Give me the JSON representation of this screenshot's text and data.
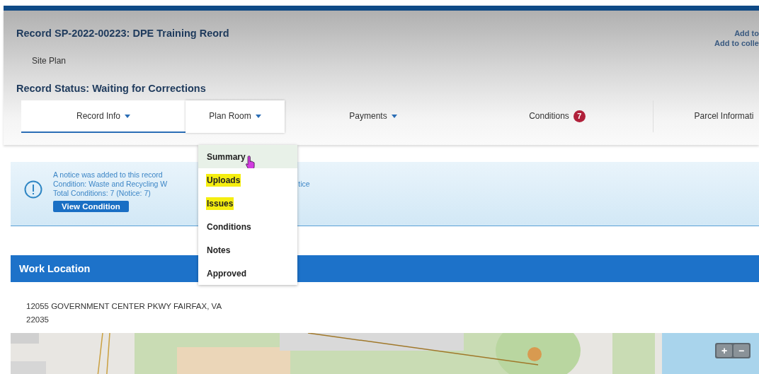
{
  "header": {
    "title": "Record SP-2022-00223: DPE Training Reord",
    "subtitle": "Site Plan",
    "status": "Record Status: Waiting for Corrections",
    "links": [
      "Add to",
      "Add to colle"
    ]
  },
  "tabs": [
    {
      "label": "Record Info",
      "caret": true,
      "selected": true,
      "open": false
    },
    {
      "label": "Plan Room",
      "caret": true,
      "selected": false,
      "open": true
    },
    {
      "label": "Payments",
      "caret": true,
      "selected": false,
      "open": false
    },
    {
      "label": "Conditions",
      "caret": false,
      "badge": "7",
      "selected": false,
      "open": false
    },
    {
      "label": "Parcel Informati",
      "caret": false,
      "selected": false,
      "open": false
    }
  ],
  "dropdown": {
    "items": [
      {
        "label": "Summary",
        "selected": true,
        "highlighted": false
      },
      {
        "label": "Uploads",
        "selected": false,
        "highlighted": true
      },
      {
        "label": "Issues",
        "selected": false,
        "highlighted": true
      },
      {
        "label": "Conditions",
        "selected": false,
        "highlighted": false
      },
      {
        "label": "Notes",
        "selected": false,
        "highlighted": false
      },
      {
        "label": "Approved",
        "selected": false,
        "highlighted": false
      }
    ]
  },
  "notice": {
    "lines": [
      "A notice was added to this record",
      "Condition: Waste and Recycling W",
      "Total Conditions: 7  (Notice: 7)"
    ],
    "tail": "tice",
    "button": "View Condition"
  },
  "work_location": {
    "title": "Work Location",
    "address": [
      "12055 GOVERNMENT CENTER PKWY FAIRFAX, VA",
      "22035"
    ],
    "map": {
      "zoom_in": "+",
      "zoom_out": "−"
    }
  }
}
